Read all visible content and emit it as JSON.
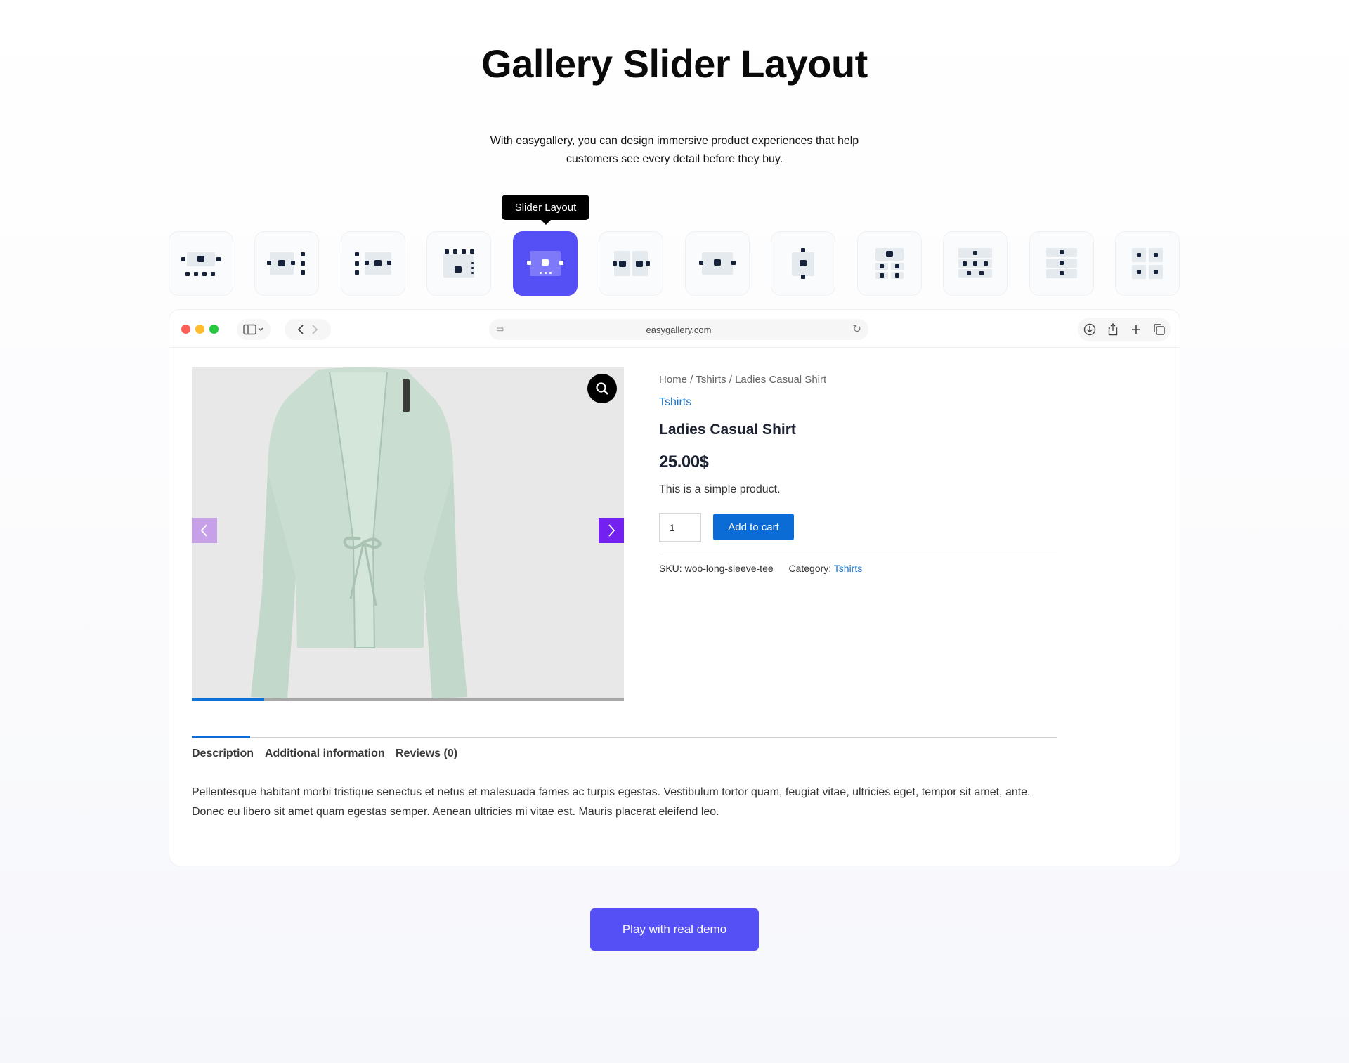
{
  "page": {
    "title": "Gallery Slider Layout",
    "subtitle_line1": "With easygallery, you can design immersive product experiences that help",
    "subtitle_line2": "customers see every detail before they buy."
  },
  "layout_selector": {
    "tooltip": "Slider Layout",
    "active_index": 4,
    "options": [
      {
        "icon": "layout-slider-thumbs-bottom-icon"
      },
      {
        "icon": "layout-slider-thumbs-right-icon"
      },
      {
        "icon": "layout-slider-thumbs-left-icon"
      },
      {
        "icon": "layout-slider-thumbs-top-icon"
      },
      {
        "icon": "layout-slider-dots-icon"
      },
      {
        "icon": "layout-two-column-icon"
      },
      {
        "icon": "layout-slider-plain-icon"
      },
      {
        "icon": "layout-vertical-slider-icon"
      },
      {
        "icon": "layout-grid-featured-icon"
      },
      {
        "icon": "layout-grid-mixed-icon"
      },
      {
        "icon": "layout-stacked-icon"
      },
      {
        "icon": "layout-grid-2x2-icon"
      }
    ]
  },
  "browser": {
    "url": "easygallery.com"
  },
  "product": {
    "breadcrumb": "Home / Tshirts / Ladies Casual Shirt",
    "category_link": "Tshirts",
    "name": "Ladies Casual Shirt",
    "price": "25.00$",
    "short_description": "This is a simple product.",
    "quantity": "1",
    "add_to_cart": "Add to cart",
    "sku_label": "SKU:",
    "sku_value": "woo-long-sleeve-tee",
    "category_label": "Category:",
    "category_value": "Tshirts",
    "slider_progress": 0.167
  },
  "tabs": {
    "description": "Description",
    "additional": "Additional information",
    "reviews": "Reviews (0)"
  },
  "description_text_line1": "Pellentesque habitant morbi tristique senectus et netus et malesuada fames ac turpis egestas. Vestibulum tortor quam, feugiat vitae, ultricies eget, tempor sit amet, ante.",
  "description_text_line2": "Donec eu libero sit amet quam egestas semper. Aenean ultricies mi vitae est. Mauris placerat eleifend leo.",
  "cta": {
    "label": "Play with real demo"
  },
  "colors": {
    "accent": "#5550f5",
    "link": "#1a73c8",
    "cart_button": "#0c6cd6",
    "slider_prev": "#c6a1ea",
    "slider_next": "#7221ee"
  }
}
